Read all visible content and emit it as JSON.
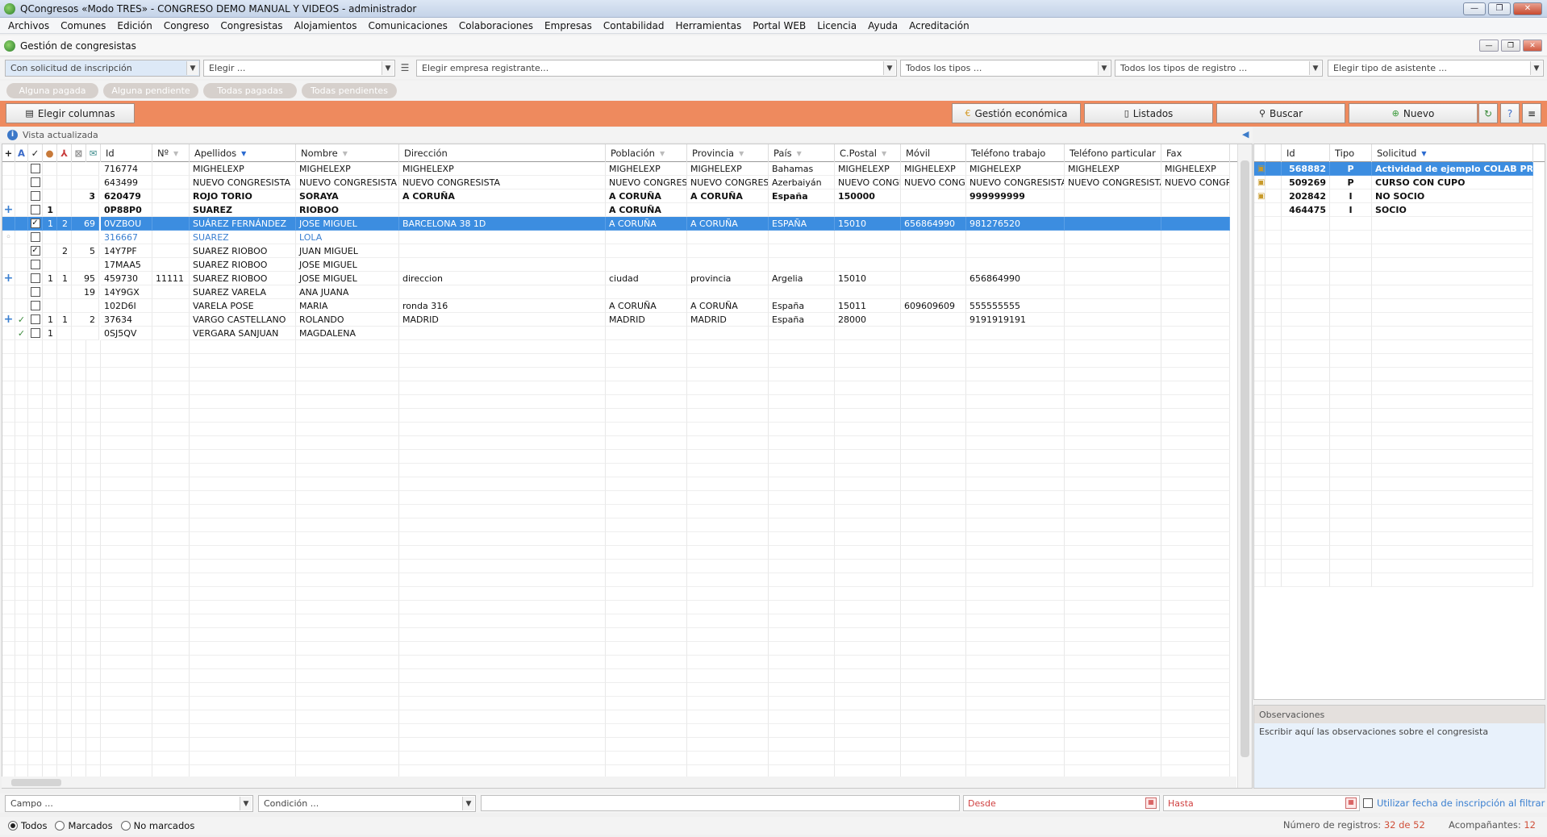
{
  "window": {
    "title": "QCongresos «Modo TRES» - CONGRESO DEMO MANUAL Y VIDEOS - administrador"
  },
  "menu": [
    "Archivos",
    "Comunes",
    "Edición",
    "Congreso",
    "Congresistas",
    "Alojamientos",
    "Comunicaciones",
    "Colaboraciones",
    "Empresas",
    "Contabilidad",
    "Herramientas",
    "Portal WEB",
    "Licencia",
    "Ayuda",
    "Acreditación"
  ],
  "subwindow": {
    "title": "Gestión de congresistas"
  },
  "filters": {
    "solicitud": "Con solicitud de inscripción",
    "elegir": "Elegir ...",
    "empresa": "Elegir empresa registrante...",
    "tipos": "Todos los tipos ...",
    "tipos_registro": "Todos los tipos de registro ...",
    "tipo_asistente": "Elegir tipo de asistente ..."
  },
  "payment_pills": [
    "Alguna pagada",
    "Alguna pendiente",
    "Todas pagadas",
    "Todas pendientes"
  ],
  "toolbar": {
    "elegir_columnas": "Elegir columnas",
    "gestion_economica": "Gestión económica",
    "listados": "Listados",
    "buscar": "Buscar",
    "nuevo": "Nuevo"
  },
  "status": {
    "text": "Vista actualizada"
  },
  "grid": {
    "columns": [
      "Id",
      "Nº",
      "Apellidos",
      "Nombre",
      "Dirección",
      "Población",
      "Provincia",
      "País",
      "C.Postal",
      "Móvil",
      "Teléfono trabajo",
      "Teléfono particular",
      "Fax"
    ],
    "rows": [
      {
        "plus": "",
        "tick": "",
        "chk": false,
        "c1": "",
        "c2": "",
        "c3": "",
        "id": "716774",
        "num": "",
        "apellidos": "MIGHELEXP",
        "nombre": "MIGHELEXP",
        "direccion": "MIGHELEXP",
        "poblacion": "MIGHELEXP",
        "provincia": "MIGHELEXP",
        "pais": "Bahamas",
        "cpostal": "MIGHELEXP",
        "movil": "MIGHELEXP",
        "tel_trabajo": "MIGHELEXP",
        "tel_particular": "MIGHELEXP",
        "fax": "MIGHELEXP"
      },
      {
        "plus": "",
        "tick": "",
        "chk": false,
        "c1": "",
        "c2": "",
        "c3": "",
        "id": "643499",
        "num": "",
        "apellidos": "NUEVO CONGRESISTA",
        "nombre": "NUEVO CONGRESISTA",
        "direccion": "NUEVO CONGRESISTA",
        "poblacion": "NUEVO CONGRESIS",
        "provincia": "NUEVO CONGRESIS",
        "pais": "Azerbaiyán",
        "cpostal": "NUEVO CONGR",
        "movil": "NUEVO CONGR",
        "tel_trabajo": "NUEVO CONGRESISTA",
        "tel_particular": "NUEVO CONGRESISTA",
        "fax": "NUEVO CONGR"
      },
      {
        "plus": "",
        "tick": "",
        "chk": false,
        "c1": "",
        "c2": "",
        "c3": "3",
        "id": "620479",
        "num": "",
        "apellidos": "ROJO TORIO",
        "nombre": "SORAYA",
        "direccion": "A CORUÑA",
        "poblacion": "A CORUÑA",
        "provincia": "A CORUÑA",
        "pais": "España",
        "cpostal": "150000",
        "movil": "",
        "tel_trabajo": "999999999",
        "tel_particular": "",
        "fax": ""
      },
      {
        "plus": "+",
        "tick": "",
        "chk": false,
        "c1": "1",
        "c2": "",
        "c3": "",
        "id": "0P88P0",
        "num": "",
        "apellidos": "SUAREZ",
        "nombre": "RIOBOO",
        "direccion": "",
        "poblacion": "A CORUÑA",
        "provincia": "",
        "pais": "",
        "cpostal": "",
        "movil": "",
        "tel_trabajo": "",
        "tel_particular": "",
        "fax": ""
      },
      {
        "plus": "",
        "tick": "",
        "chk": true,
        "c1": "1",
        "c2": "2",
        "c3": "69",
        "id": "0VZBOU",
        "num": "",
        "apellidos": "SUÁREZ FERNÁNDEZ",
        "nombre": "JOSE MIGUEL",
        "direccion": "BARCELONA 38 1D",
        "poblacion": "A CORUÑA",
        "provincia": "A CORUÑA",
        "pais": "ESPAÑA",
        "cpostal": "15010",
        "movil": "656864990",
        "tel_trabajo": "981276520",
        "tel_particular": "",
        "fax": ""
      },
      {
        "plus": "◦",
        "tick": "",
        "chk": false,
        "c1": "",
        "c2": "",
        "c3": "",
        "id": "316667",
        "num": "",
        "apellidos": "SUAREZ",
        "nombre": "LOLA",
        "direccion": "",
        "poblacion": "",
        "provincia": "",
        "pais": "",
        "cpostal": "",
        "movil": "",
        "tel_trabajo": "",
        "tel_particular": "",
        "fax": ""
      },
      {
        "plus": "",
        "tick": "",
        "chk": true,
        "c1": "",
        "c2": "2",
        "c3": "5",
        "id": "14Y7PF",
        "num": "",
        "apellidos": "SUAREZ RIOBOO",
        "nombre": "JUAN MIGUEL",
        "direccion": "",
        "poblacion": "",
        "provincia": "",
        "pais": "",
        "cpostal": "",
        "movil": "",
        "tel_trabajo": "",
        "tel_particular": "",
        "fax": ""
      },
      {
        "plus": "",
        "tick": "",
        "chk": false,
        "c1": "",
        "c2": "",
        "c3": "",
        "id": "17MAA5",
        "num": "",
        "apellidos": "SUAREZ RIOBOO",
        "nombre": "JOSE MIGUEL",
        "direccion": "",
        "poblacion": "",
        "provincia": "",
        "pais": "",
        "cpostal": "",
        "movil": "",
        "tel_trabajo": "",
        "tel_particular": "",
        "fax": ""
      },
      {
        "plus": "+",
        "tick": "",
        "chk": false,
        "c1": "1",
        "c2": "1",
        "c3": "95",
        "id": "459730",
        "num": "11111",
        "apellidos": "SUAREZ RIOBOO",
        "nombre": "JOSE MIGUEL",
        "direccion": "direccion",
        "poblacion": "ciudad",
        "provincia": "provincia",
        "pais": "Argelia",
        "cpostal": "15010",
        "movil": "",
        "tel_trabajo": "656864990",
        "tel_particular": "",
        "fax": ""
      },
      {
        "plus": "",
        "tick": "",
        "chk": false,
        "c1": "",
        "c2": "",
        "c3": "19",
        "id": "14Y9GX",
        "num": "",
        "apellidos": "SUAREZ VARELA",
        "nombre": "ANA JUANA",
        "direccion": "",
        "poblacion": "",
        "provincia": "",
        "pais": "",
        "cpostal": "",
        "movil": "",
        "tel_trabajo": "",
        "tel_particular": "",
        "fax": ""
      },
      {
        "plus": "",
        "tick": "",
        "chk": false,
        "c1": "",
        "c2": "",
        "c3": "",
        "id": "102D6I",
        "num": "",
        "apellidos": "VARELA POSE",
        "nombre": "MARIA",
        "direccion": "ronda 316",
        "poblacion": "A CORUÑA",
        "provincia": "A CORUÑA",
        "pais": "España",
        "cpostal": "15011",
        "movil": "609609609",
        "tel_trabajo": "555555555",
        "tel_particular": "",
        "fax": ""
      },
      {
        "plus": "+",
        "tick": "✓",
        "chk": false,
        "c1": "1",
        "c2": "1",
        "c3": "2",
        "id": "37634",
        "num": "",
        "apellidos": "VARGO CASTELLANO",
        "nombre": "ROLANDO",
        "direccion": "MADRID",
        "poblacion": "MADRID",
        "provincia": "MADRID",
        "pais": "España",
        "cpostal": "28000",
        "movil": "",
        "tel_trabajo": "9191919191",
        "tel_particular": "",
        "fax": ""
      },
      {
        "plus": "",
        "tick": "✓",
        "chk": false,
        "c1": "1",
        "c2": "",
        "c3": "",
        "id": "0SJ5QV",
        "num": "",
        "apellidos": "VERGARA SANJUAN",
        "nombre": "MAGDALENA",
        "direccion": "",
        "poblacion": "",
        "provincia": "",
        "pais": "",
        "cpostal": "",
        "movil": "",
        "tel_trabajo": "",
        "tel_particular": "",
        "fax": ""
      }
    ]
  },
  "side_grid": {
    "columns": [
      "Id",
      "Tipo",
      "Solicitud"
    ],
    "rows": [
      {
        "id": "568882",
        "tipo": "P",
        "solicitud": "Actividad de ejemplo COLAB PROGRAM"
      },
      {
        "id": "509269",
        "tipo": "P",
        "solicitud": "CURSO CON CUPO"
      },
      {
        "id": "202842",
        "tipo": "I",
        "solicitud": "NO SOCIO"
      },
      {
        "id": "464475",
        "tipo": "I",
        "solicitud": "SOCIO"
      }
    ]
  },
  "observaciones": {
    "title": "Observaciones",
    "placeholder": "Escribir aquí las observaciones sobre el congresista"
  },
  "bottom": {
    "campo": "Campo ...",
    "condicion": "Condición ...",
    "desde": "Desde",
    "hasta": "Hasta",
    "usar_fecha": "Utilizar fecha de inscripción al filtrar"
  },
  "radios": [
    "Todos",
    "Marcados",
    "No marcados"
  ],
  "counts": {
    "registros_label": "Número de registros:",
    "registros_value": "32 de 52",
    "acompanantes_label": "Acompañantes:",
    "acompanantes_value": "12"
  }
}
